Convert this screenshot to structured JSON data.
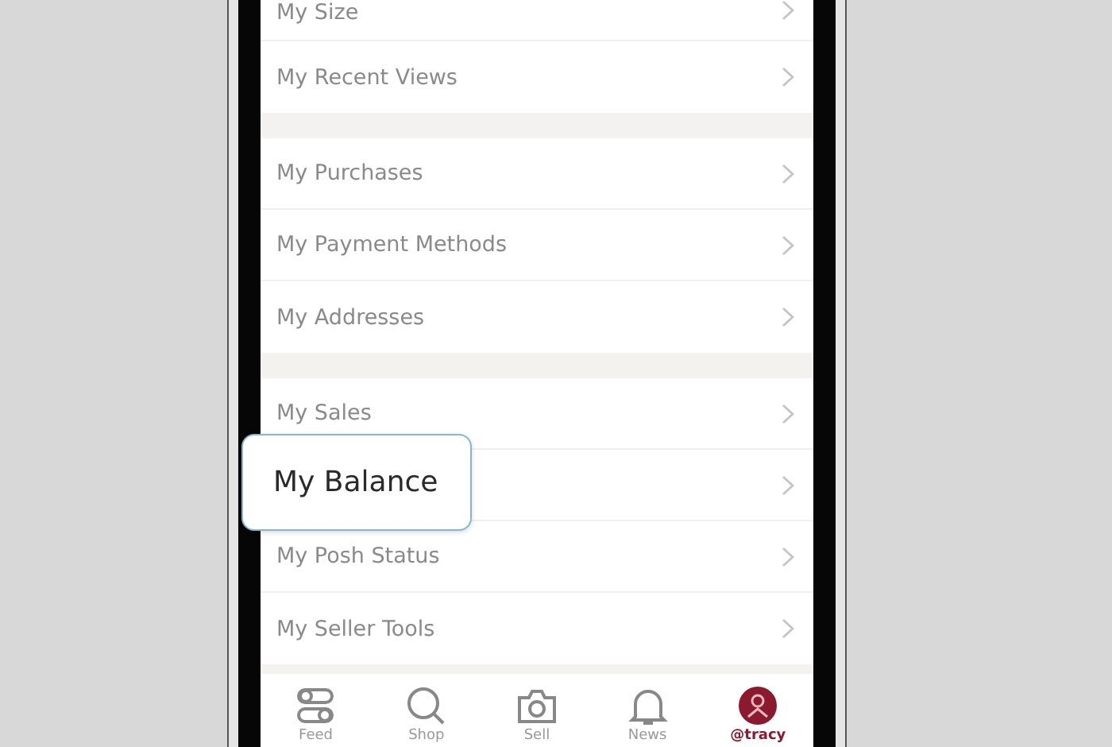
{
  "menu_groups": [
    {
      "items": [
        {
          "label": "My Size"
        },
        {
          "label": "My Recent Views"
        }
      ]
    },
    {
      "items": [
        {
          "label": "My Purchases"
        },
        {
          "label": "My Payment Methods"
        },
        {
          "label": "My Addresses"
        }
      ]
    },
    {
      "items": [
        {
          "label": "My Sales"
        },
        {
          "kind": "covered"
        },
        {
          "label": "My Posh Status"
        },
        {
          "label": "My Seller Tools"
        }
      ]
    }
  ],
  "callout": {
    "text": "My Balance"
  },
  "tab_bar": [
    {
      "kind": "feed",
      "label": "Feed",
      "selected": false
    },
    {
      "kind": "shop",
      "label": "Shop",
      "selected": false
    },
    {
      "kind": "sell",
      "label": "Sell",
      "selected": false
    },
    {
      "kind": "news",
      "label": "News",
      "selected": false
    },
    {
      "kind": "profile",
      "label": "@tracy",
      "selected": true
    }
  ]
}
